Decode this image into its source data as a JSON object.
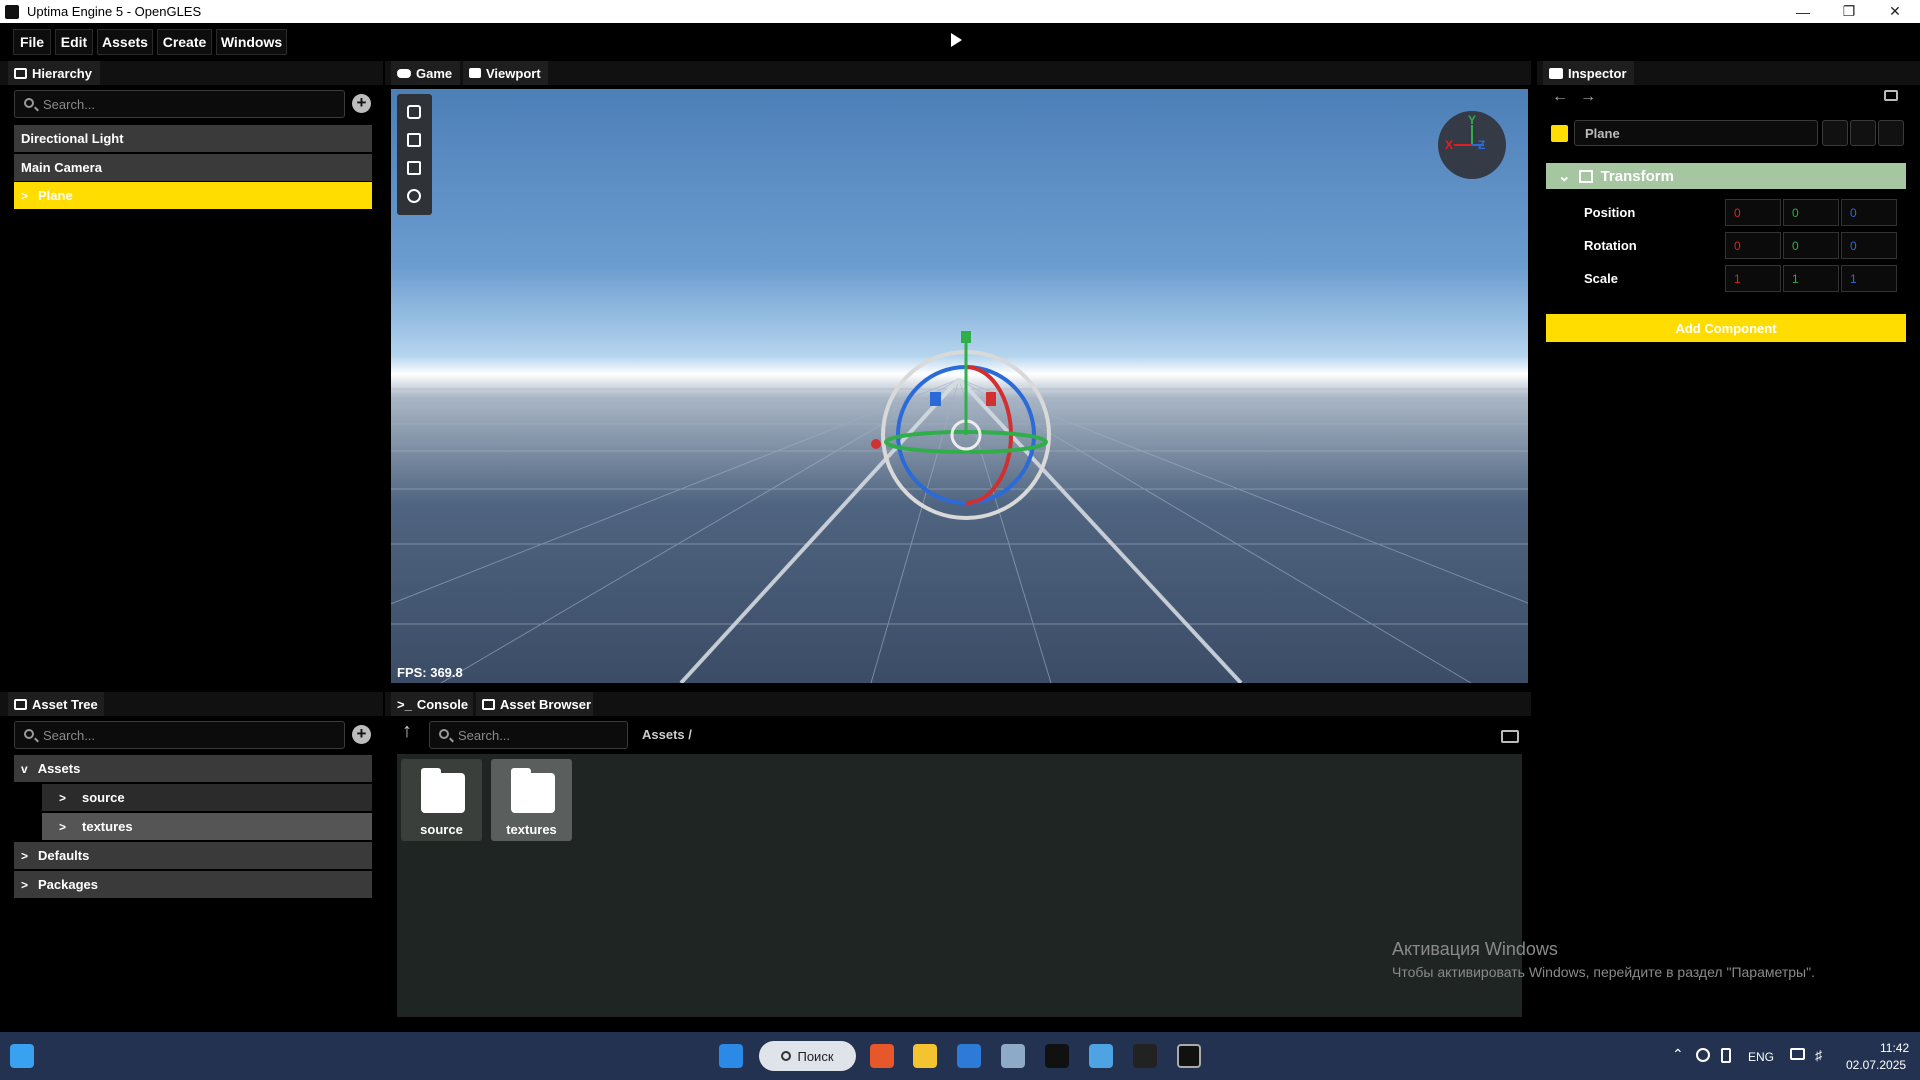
{
  "window": {
    "title": "Uptima Engine 5 - OpenGLES"
  },
  "menu": [
    "File",
    "Edit",
    "Assets",
    "Create",
    "Windows"
  ],
  "hierarchy": {
    "tab": "Hierarchy",
    "search_placeholder": "Search...",
    "items": [
      "Directional Light",
      "Main Camera",
      "Plane"
    ],
    "selected": "Plane"
  },
  "viewport": {
    "tabs": [
      "Game",
      "Viewport"
    ],
    "fps_text": "FPS: 369.8",
    "gizmo_labels": {
      "x": "X",
      "y": "Y",
      "z": "Z"
    }
  },
  "inspector": {
    "tab": "Inspector",
    "object_name": "Plane",
    "component": "Transform",
    "properties": [
      {
        "label": "Position",
        "values": [
          "0",
          "0",
          "0"
        ]
      },
      {
        "label": "Rotation",
        "values": [
          "0",
          "0",
          "0"
        ]
      },
      {
        "label": "Scale",
        "values": [
          "1",
          "1",
          "1"
        ]
      }
    ],
    "add_component": "Add Component"
  },
  "asset_tree": {
    "tab": "Asset Tree",
    "search_placeholder": "Search...",
    "items": [
      "Assets",
      "source",
      "textures",
      "Defaults",
      "Packages"
    ]
  },
  "bottom": {
    "tabs": [
      "Console",
      "Asset Browser"
    ],
    "search_placeholder": "Search...",
    "path": "Assets /",
    "assets": [
      "source",
      "textures"
    ]
  },
  "watermark": {
    "title": "Активация Windows",
    "subtitle": "Чтобы активировать Windows, перейдите в раздел \"Параметры\"."
  },
  "taskbar": {
    "search": "Поиск",
    "lang": "ENG",
    "time": "11:42",
    "date": "02.07.2025"
  },
  "colors": {
    "accent": "#ffdd00",
    "transform_header": "#a6c5a1",
    "x_axis": "#e02020",
    "y_axis": "#2fae4a",
    "z_axis": "#2a6bd8"
  }
}
